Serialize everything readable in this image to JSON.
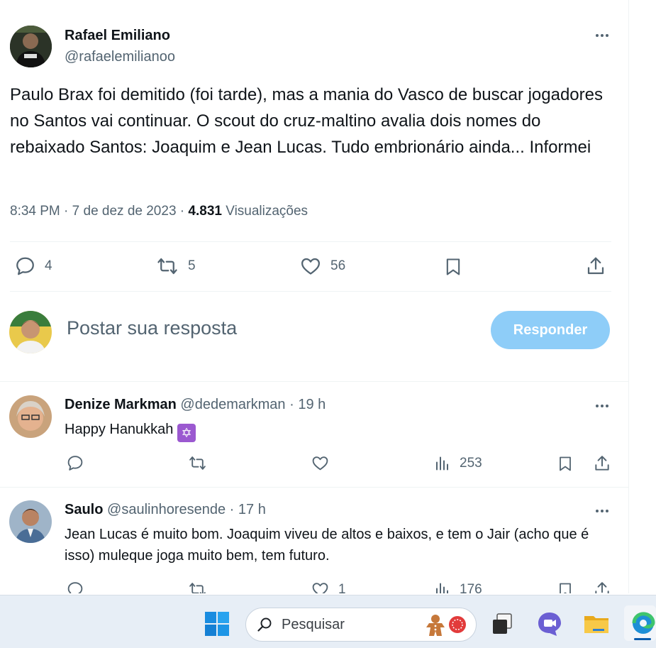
{
  "tweet": {
    "author_name": "Rafael Emiliano",
    "author_handle": "@rafaelemilianoo",
    "text": "Paulo Brax foi demitido (foi tarde), mas a mania do Vasco de buscar jogadores no Santos vai continuar. O scout do cruz-maltino avalia dois nomes do rebaixado Santos: Joaquim e Jean Lucas. Tudo embrionário ainda... Informei",
    "time": "8:34 PM",
    "date": "7 de dez de 2023",
    "views_count": "4.831",
    "views_label": "Visualizações",
    "replies": "4",
    "retweets": "5",
    "likes": "56"
  },
  "reply_composer": {
    "placeholder": "Postar sua resposta",
    "button_label": "Responder"
  },
  "replies": [
    {
      "name": "Denize Markman",
      "handle": "@dedemarkman",
      "time": "19 h",
      "text": "Happy Hanukkah",
      "emoji": "✡",
      "views": "253"
    },
    {
      "name": "Saulo",
      "handle": "@saulinhoresende",
      "time": "17 h",
      "text": "Jean Lucas é muito bom. Joaquim viveu de altos e baixos, e tem o Jair (acho que é isso) muleque joga muito bem, tem futuro.",
      "likes": "1",
      "views": "176"
    }
  ],
  "taskbar": {
    "search_label": "Pesquisar"
  },
  "colors": {
    "accent": "#1d9bf0",
    "reply_button": "#8ecdf8",
    "secondary_text": "#536471"
  }
}
